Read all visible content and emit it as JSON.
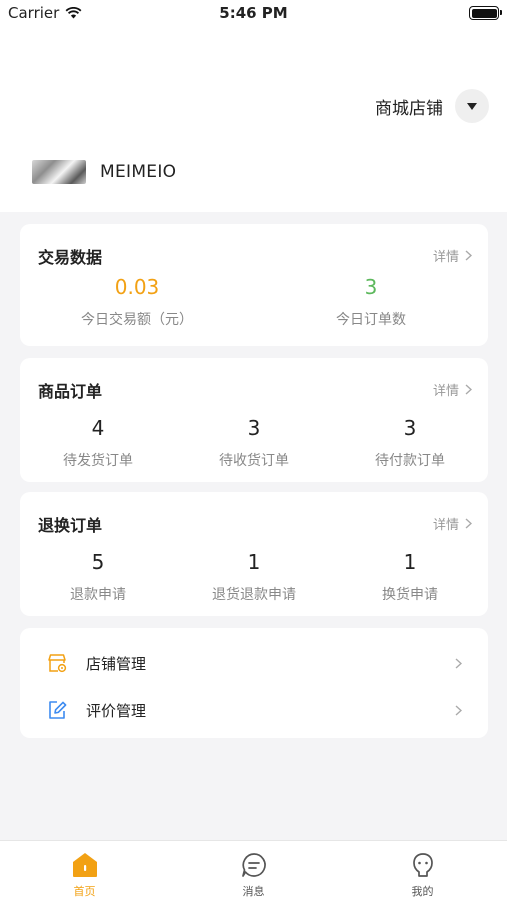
{
  "status_bar": {
    "carrier": "Carrier",
    "time": "5:46 PM"
  },
  "header": {
    "store_switch_label": "商城店铺"
  },
  "shop": {
    "name": "MEIMEIO"
  },
  "trade": {
    "title": "交易数据",
    "detail": "详情",
    "stats": [
      {
        "value": "0.03",
        "label": "今日交易额（元）"
      },
      {
        "value": "3",
        "label": "今日订单数"
      }
    ]
  },
  "goods_orders": {
    "title": "商品订单",
    "detail": "详情",
    "stats": [
      {
        "value": "4",
        "label": "待发货订单"
      },
      {
        "value": "3",
        "label": "待收货订单"
      },
      {
        "value": "3",
        "label": "待付款订单"
      }
    ]
  },
  "refund_orders": {
    "title": "退换订单",
    "detail": "详情",
    "stats": [
      {
        "value": "5",
        "label": "退款申请"
      },
      {
        "value": "1",
        "label": "退货退款申请"
      },
      {
        "value": "1",
        "label": "换货申请"
      }
    ]
  },
  "menu": {
    "items": [
      {
        "label": "店铺管理",
        "icon": "store-settings-icon"
      },
      {
        "label": "评价管理",
        "icon": "edit-review-icon"
      }
    ]
  },
  "tabbar": {
    "items": [
      {
        "label": "首页",
        "icon": "home-icon",
        "active": true
      },
      {
        "label": "消息",
        "icon": "message-icon",
        "active": false
      },
      {
        "label": "我的",
        "icon": "profile-icon",
        "active": false
      }
    ]
  },
  "colors": {
    "accent": "#f2a114",
    "green": "#5cb85c",
    "background": "#f4f4f6"
  }
}
